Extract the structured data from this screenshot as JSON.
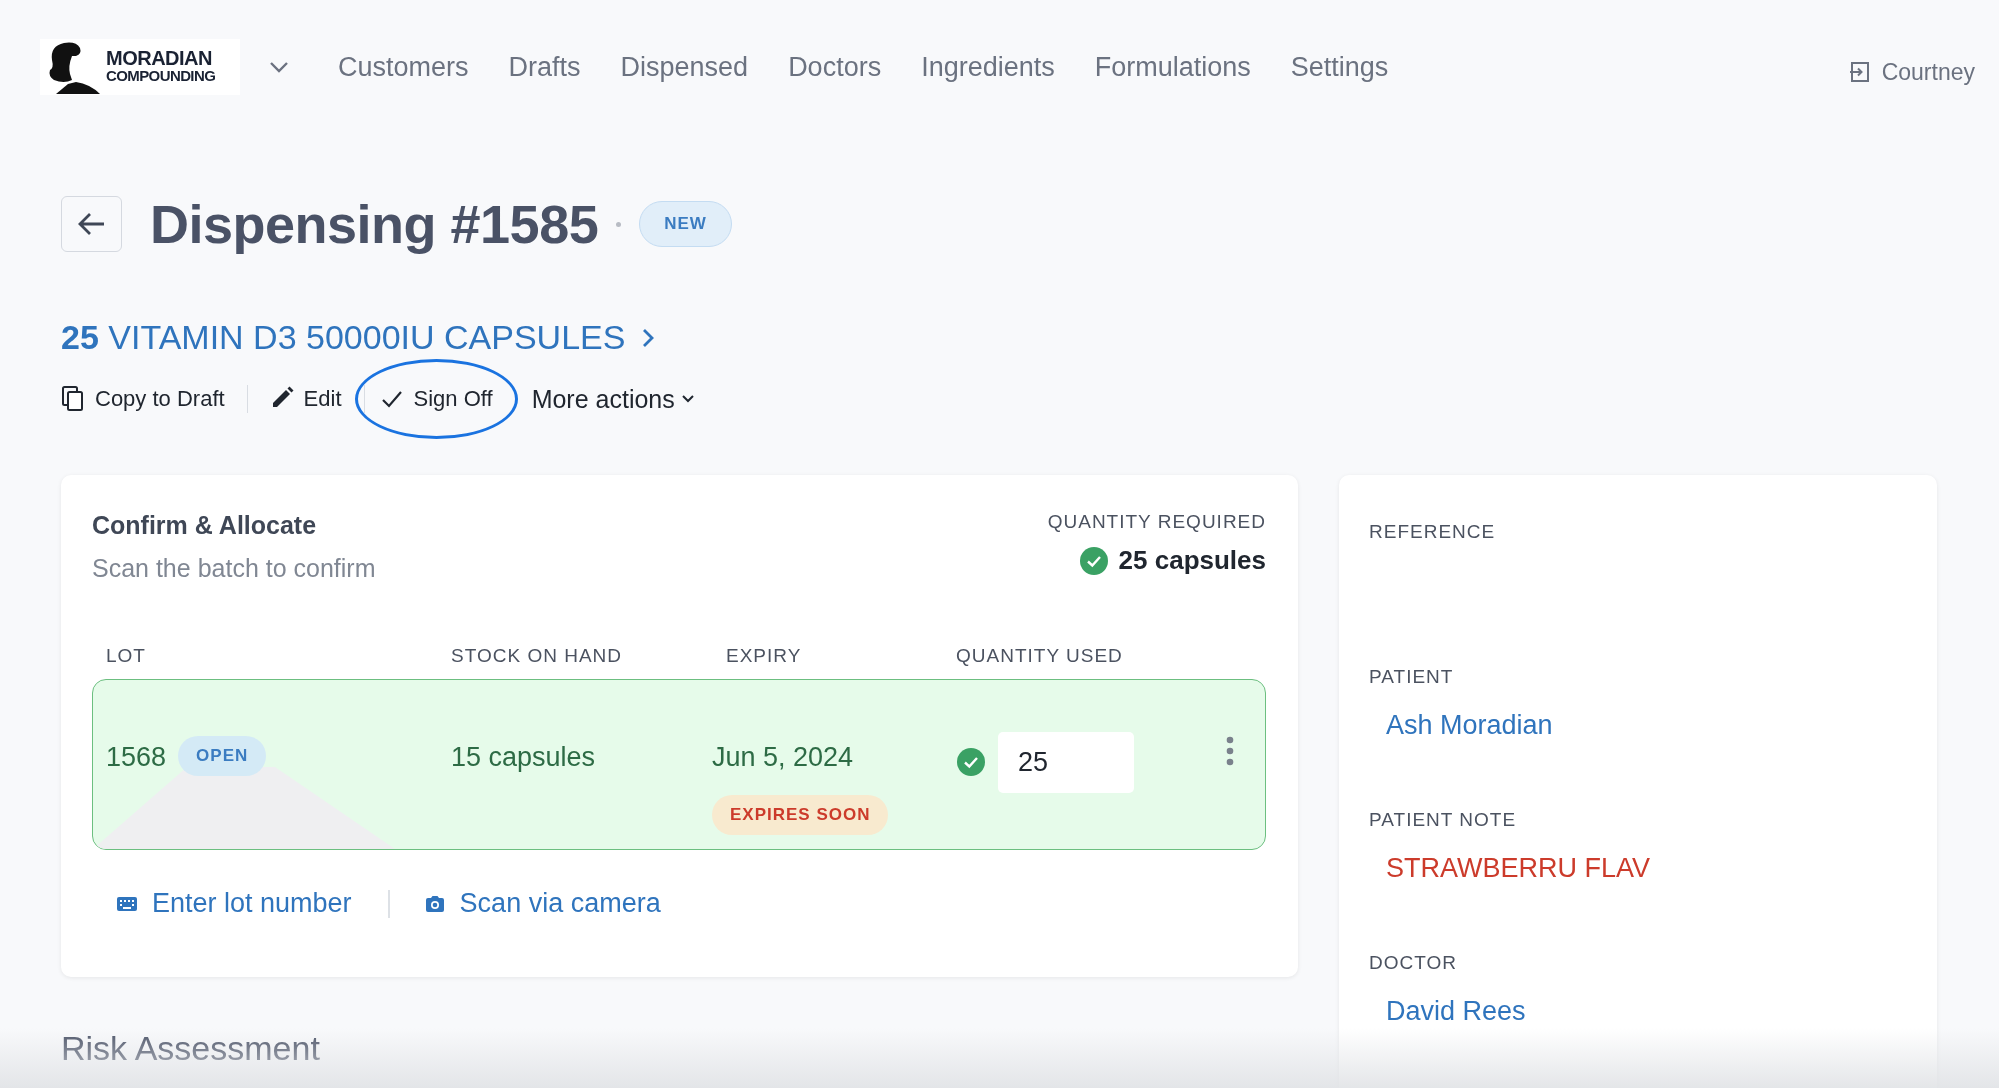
{
  "brand": {
    "line1": "MORADIAN",
    "line2": "COMPOUNDING"
  },
  "nav": [
    "Customers",
    "Drafts",
    "Dispensed",
    "Doctors",
    "Ingredients",
    "Formulations",
    "Settings"
  ],
  "user": {
    "name": "Courtney"
  },
  "page": {
    "title": "Dispensing #1585",
    "status": "NEW"
  },
  "product": {
    "quantity": "25",
    "name": "VITAMIN D3 50000IU CAPSULES"
  },
  "actions": [
    {
      "kind": "copy",
      "label": "Copy to Draft",
      "highlighted": false
    },
    {
      "kind": "edit",
      "label": "Edit",
      "highlighted": false
    },
    {
      "kind": "check",
      "label": "Sign Off",
      "highlighted": true
    },
    {
      "kind": "menu",
      "label": "More actions",
      "highlighted": false
    }
  ],
  "allocate": {
    "title": "Confirm & Allocate",
    "subtitle": "Scan the batch to confirm",
    "required_label": "QUANTITY REQUIRED",
    "required_value": "25 capsules",
    "required_met": true,
    "columns": [
      "LOT",
      "STOCK ON HAND",
      "EXPIRY",
      "QUANTITY USED"
    ],
    "rows": [
      {
        "lot": "1568",
        "lot_status": "OPEN",
        "stock": "15 capsules",
        "expiry": "Jun 5, 2024",
        "expiry_warning": "EXPIRES SOON",
        "quantity_used": "25",
        "confirmed": true
      }
    ],
    "links": [
      {
        "kind": "keyboard",
        "label": "Enter lot number"
      },
      {
        "kind": "camera",
        "label": "Scan via camera"
      }
    ]
  },
  "risk": {
    "title": "Risk Assessment"
  },
  "details": [
    {
      "kind": "empty",
      "label": "REFERENCE"
    },
    {
      "kind": "link",
      "label": "PATIENT",
      "value": "Ash Moradian"
    },
    {
      "kind": "alert",
      "label": "PATIENT NOTE",
      "value": "STRAWBERRU FLAV"
    },
    {
      "kind": "link",
      "label": "DOCTOR",
      "value": "David Rees"
    }
  ]
}
